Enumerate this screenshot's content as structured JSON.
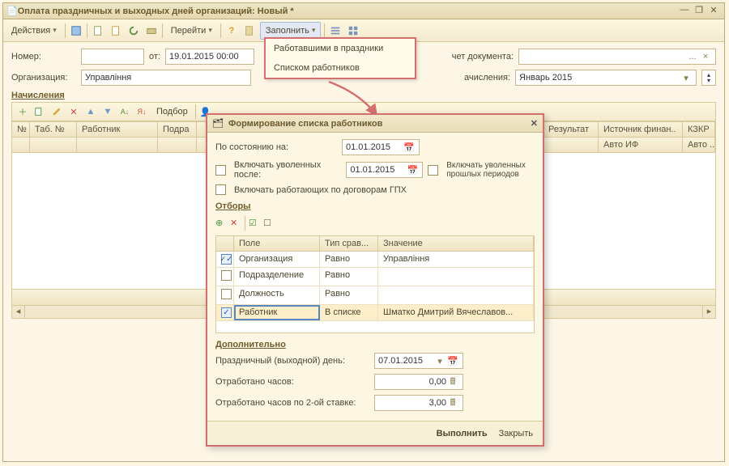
{
  "window": {
    "title": "Оплата праздничных и выходных дней организаций: Новый *",
    "actions": "Действия",
    "goto": "Перейти",
    "fill": "Заполнить"
  },
  "fields": {
    "number_label": "Номер:",
    "from_label": "от:",
    "from_value": "19.01.2015 00:00",
    "doc_label": "чет документа:",
    "org_label": "Организация:",
    "org_value": "Управління",
    "period_label": "ачисления:",
    "period_value": "Январь 2015"
  },
  "dropdown": {
    "item1": "Работавшими в праздники",
    "item2": "Списком работников"
  },
  "section": {
    "accruals": "Начисления",
    "podbor": "Подбор"
  },
  "grid_headers": [
    "№",
    "Таб. №",
    "Работник",
    "Подра",
    "Результат",
    "Источник финан..",
    "КЗКР",
    "Авто ИФ",
    "Авто ..."
  ],
  "modal": {
    "title": "Формирование списка работников",
    "as_of": "По состоянию на:",
    "as_of_val": "01.01.2015",
    "inc_fired": "Включать уволенных после:",
    "inc_fired_val": "01.01.2015",
    "inc_fired_prev": "Включать уволенных прошлых периодов",
    "inc_gph": "Включать работающих по договорам ГПХ",
    "filters_h": "Отборы",
    "fcols": [
      "",
      "Поле",
      "Тип срав...",
      "Значение"
    ],
    "frows": [
      {
        "chk": true,
        "field": "Организация",
        "op": "Равно",
        "val": "Управління"
      },
      {
        "chk": false,
        "field": "Подразделение",
        "op": "Равно",
        "val": ""
      },
      {
        "chk": false,
        "field": "Должность",
        "op": "Равно",
        "val": ""
      },
      {
        "chk": true,
        "field": "Работник",
        "op": "В списке",
        "val": "Шматко Дмитрий Вячеславов..."
      }
    ],
    "add_h": "Дополнительно",
    "holiday": "Праздничный (выходной) день:",
    "holiday_val": "07.01.2015",
    "hours1": "Отработано часов:",
    "hours1_val": "0,00",
    "hours2": "Отработано часов по 2-ой ставке:",
    "hours2_val": "3,00",
    "run": "Выполнить",
    "close": "Закрыть"
  }
}
